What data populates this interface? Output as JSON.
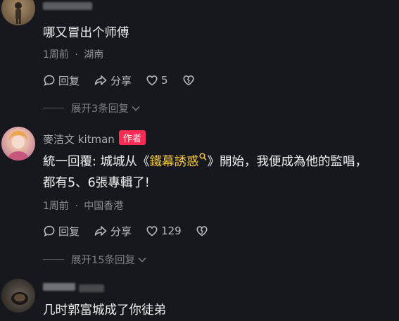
{
  "comments": [
    {
      "content": "哪又冒出个师傅",
      "time": "1周前",
      "location": "湖南",
      "reply_label": "回复",
      "share_label": "分享",
      "like_count": "5",
      "expand_label": "展开3条回复"
    },
    {
      "username": "麥洁文 kitman",
      "author_badge": "作者",
      "content_line1_prefix": "統一回覆: 城城从《",
      "content_line1_link": "鐵幕誘惑",
      "content_line1_suffix": "》開始，我便成為他的監唱，",
      "content_line2": "都有5、6張專輯了!",
      "time": "1周前",
      "location": "中国香港",
      "reply_label": "回复",
      "share_label": "分享",
      "like_count": "129",
      "expand_label": "展开15条回复"
    },
    {
      "content": "几时郭富城成了你徒弟"
    }
  ],
  "meta_separator": "·",
  "colors": {
    "background": "#16181d",
    "author_badge": "#fe2c55",
    "link_highlight": "#f5c842"
  }
}
